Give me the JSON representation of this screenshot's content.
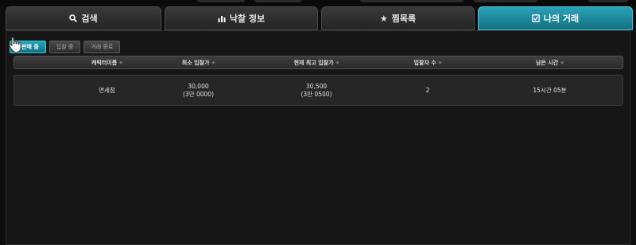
{
  "tabs": [
    {
      "label": "검색",
      "icon": "search-icon",
      "active": false
    },
    {
      "label": "낙찰 정보",
      "icon": "bar-chart-icon",
      "active": false
    },
    {
      "label": "찜목록",
      "icon": "star-icon",
      "active": false
    },
    {
      "label": "나의 거래",
      "icon": "checkbox-icon",
      "active": true
    }
  ],
  "subtabs": {
    "selling": "판매 중",
    "bidding": "입찰 중",
    "completed": "거래 종료"
  },
  "table": {
    "headers": {
      "character": "캐릭터이름",
      "min_bid": "최소 입찰가",
      "current_bid": "현재 최고 입찰가",
      "bidders": "입찰자 수",
      "remaining": "남은 시간"
    },
    "rows": [
      {
        "character": "면세점",
        "min_bid": "30,000",
        "min_bid_sub": "(3만 0000)",
        "current_bid": "30,500",
        "current_bid_sub": "(3만 0500)",
        "bidders": "2",
        "remaining": "15시간 05분"
      }
    ]
  },
  "colors": {
    "accent": "#1e8fa3",
    "background": "#0e0e0e",
    "panel": "#161616"
  }
}
